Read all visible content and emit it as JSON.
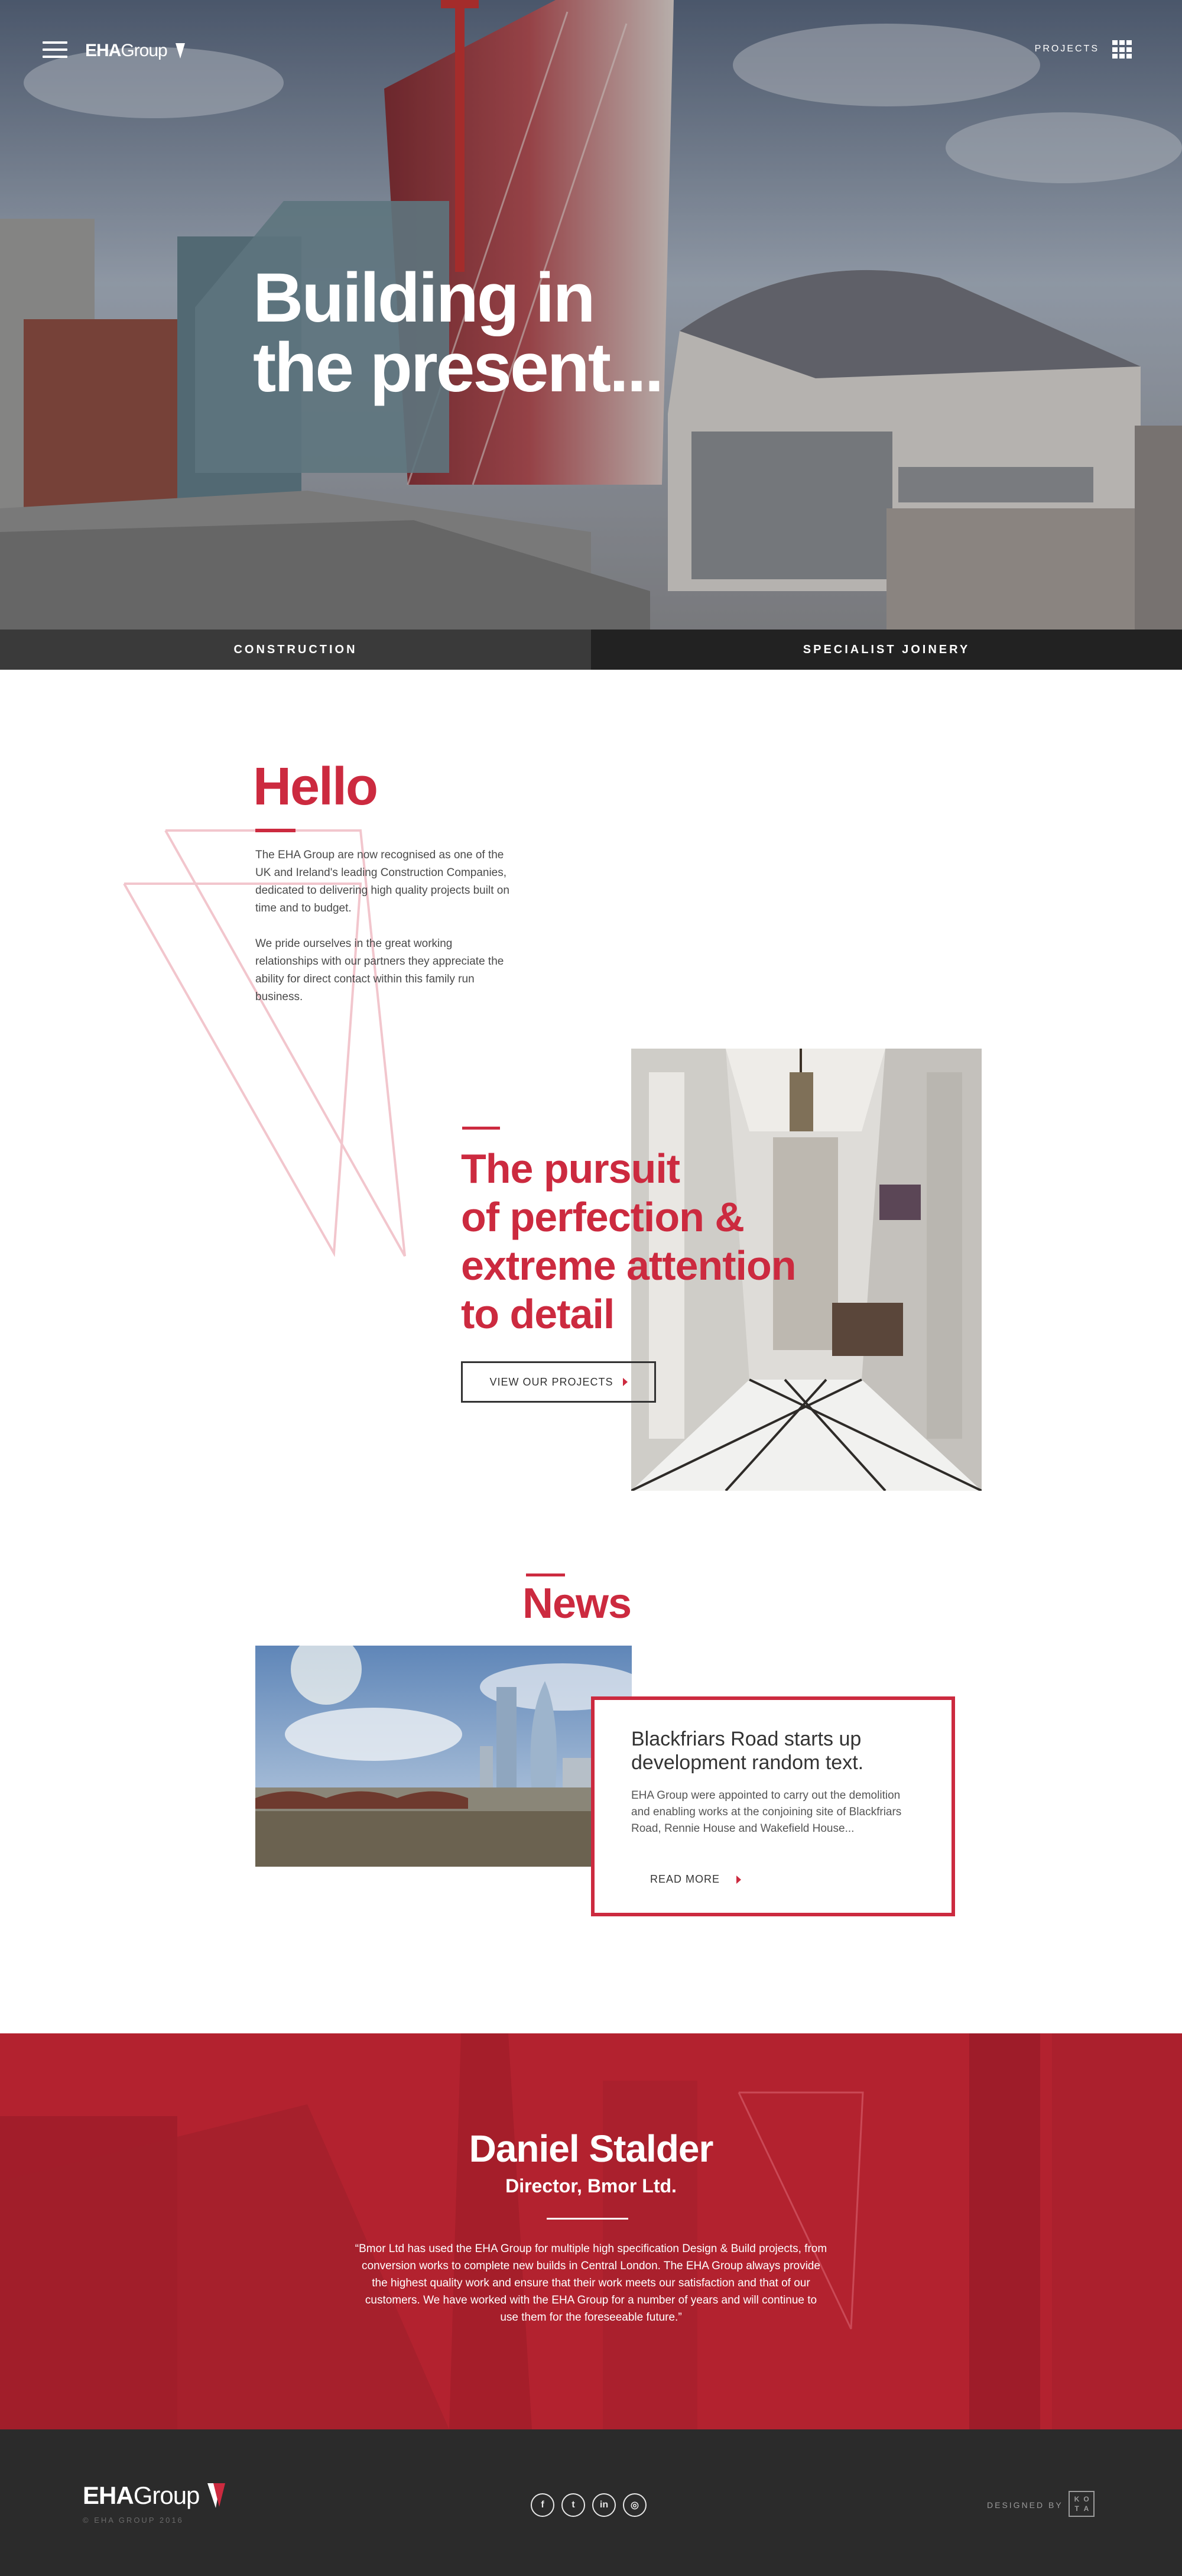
{
  "header": {
    "logo_strong": "EHA",
    "logo_light": "Group",
    "projects_label": "PROJECTS"
  },
  "hero": {
    "title_line1": "Building in",
    "title_line2": "the present..."
  },
  "split_nav": {
    "left_label": "CONSTRUCTION",
    "right_label": "SPECIALIST JOINERY"
  },
  "hello": {
    "title": "Hello",
    "paragraph1": "The EHA Group are now recognised as one of the UK and Ireland's leading Construction Companies, dedicated to delivering high quality projects built on time and to budget.",
    "paragraph2": "We pride ourselves in the great working relationships with our partners they appreciate the ability for direct contact within this family run business."
  },
  "pursuit": {
    "line1": "The pursuit",
    "line2": "of perfection &",
    "line3": "extreme attention",
    "line4": "to detail",
    "button_label": "VIEW OUR PROJECTS"
  },
  "news": {
    "title": "News",
    "headline": "Blackfriars Road starts up development random text.",
    "body": "EHA Group were appointed to carry out the demolition and enabling works at the conjoining site of Blackfriars Road, Rennie House and Wakefield House...",
    "read_more": "READ MORE"
  },
  "testimonial": {
    "name": "Daniel Stalder",
    "role": "Director, Bmor Ltd.",
    "quote": "“Bmor Ltd has used the EHA Group for multiple high specification Design & Build projects, from conversion works to complete new builds in Central London. The EHA Group always provide the highest quality work and ensure that their work meets our satisfaction and that of our customers. We have worked with the EHA Group for a number of years and will continue to use them for the foreseeable future.”"
  },
  "footer": {
    "logo_strong": "EHA",
    "logo_light": "Group",
    "copyright": "© EHA GROUP 2016",
    "designed_by": "DESIGNED BY",
    "kota_letters": [
      "K",
      "O",
      "T",
      "A"
    ],
    "socials": [
      {
        "name": "facebook-icon",
        "glyph": "f"
      },
      {
        "name": "twitter-icon",
        "glyph": "t"
      },
      {
        "name": "linkedin-icon",
        "glyph": "in"
      },
      {
        "name": "instagram-icon",
        "glyph": "◎"
      }
    ]
  },
  "colors": {
    "brand_red": "#cc2a3f",
    "testimonial_red": "#b3222f",
    "dark": "#2b2b2b"
  }
}
